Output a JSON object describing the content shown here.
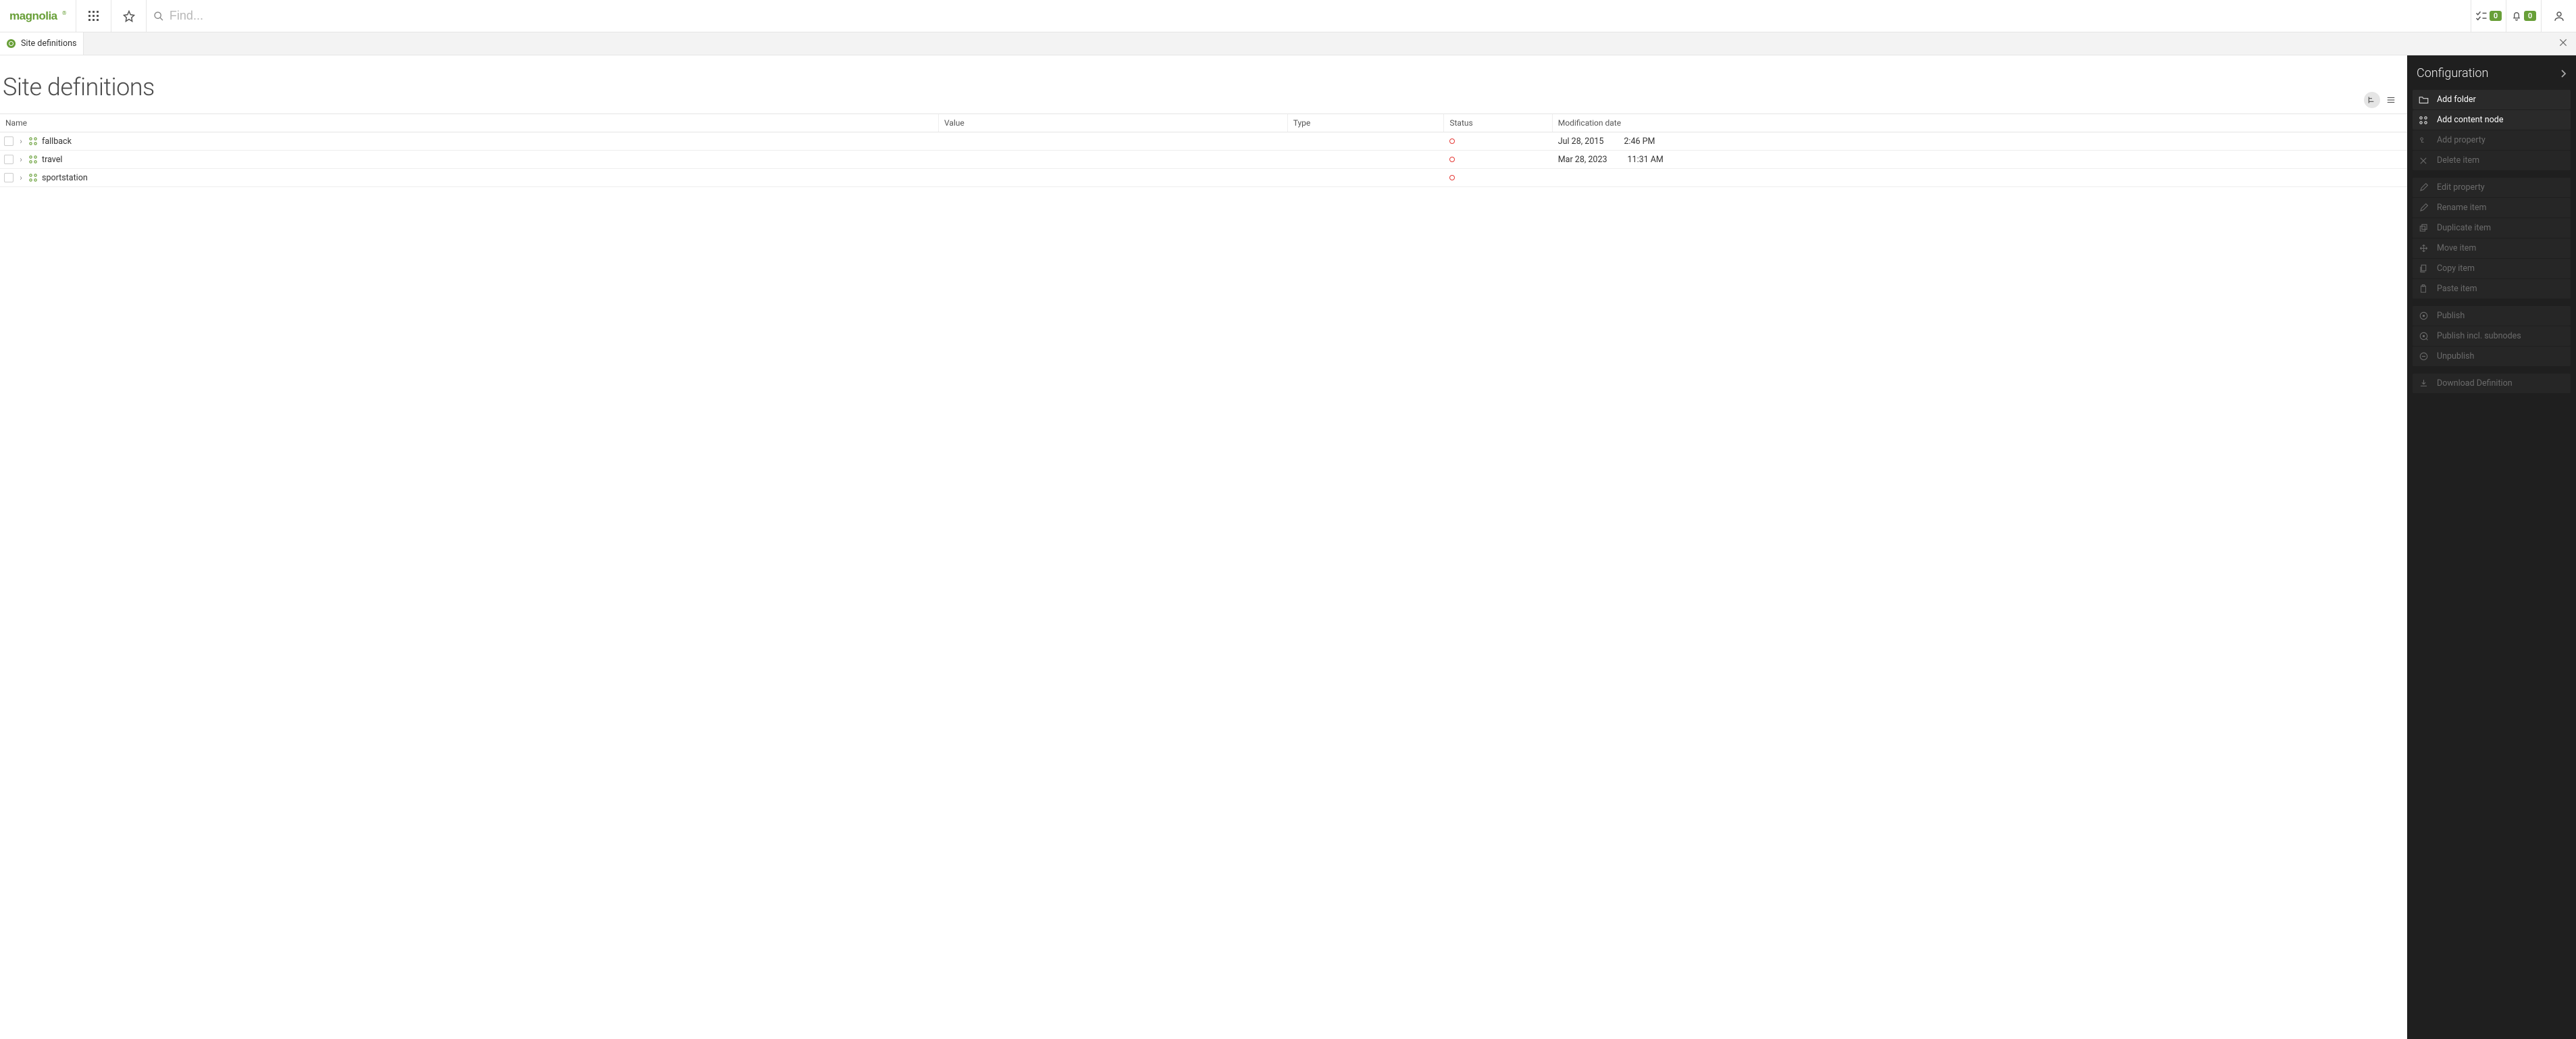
{
  "header": {
    "search_placeholder": "Find...",
    "tasks_count": "0",
    "notifications_count": "0"
  },
  "tab": {
    "label": "Site definitions"
  },
  "page": {
    "title": "Site definitions"
  },
  "table": {
    "headers": {
      "name": "Name",
      "value": "Value",
      "type": "Type",
      "status": "Status",
      "mod": "Modification date"
    },
    "rows": [
      {
        "name": "fallback",
        "value": "",
        "type": "",
        "status": "unpublished",
        "mod_date": "Jul 28, 2015",
        "mod_time": "2:46 PM"
      },
      {
        "name": "travel",
        "value": "",
        "type": "",
        "status": "unpublished",
        "mod_date": "Mar 28, 2023",
        "mod_time": "11:31 AM"
      },
      {
        "name": "sportstation",
        "value": "",
        "type": "",
        "status": "unpublished",
        "mod_date": "",
        "mod_time": ""
      }
    ]
  },
  "panel": {
    "title": "Configuration",
    "actions": {
      "add_folder": "Add folder",
      "add_content_node": "Add content node",
      "add_property": "Add property",
      "delete_item": "Delete item",
      "edit_property": "Edit property",
      "rename_item": "Rename item",
      "duplicate_item": "Duplicate item",
      "move_item": "Move item",
      "copy_item": "Copy item",
      "paste_item": "Paste item",
      "publish": "Publish",
      "publish_incl": "Publish incl. subnodes",
      "unpublish": "Unpublish",
      "download_def": "Download Definition"
    }
  }
}
